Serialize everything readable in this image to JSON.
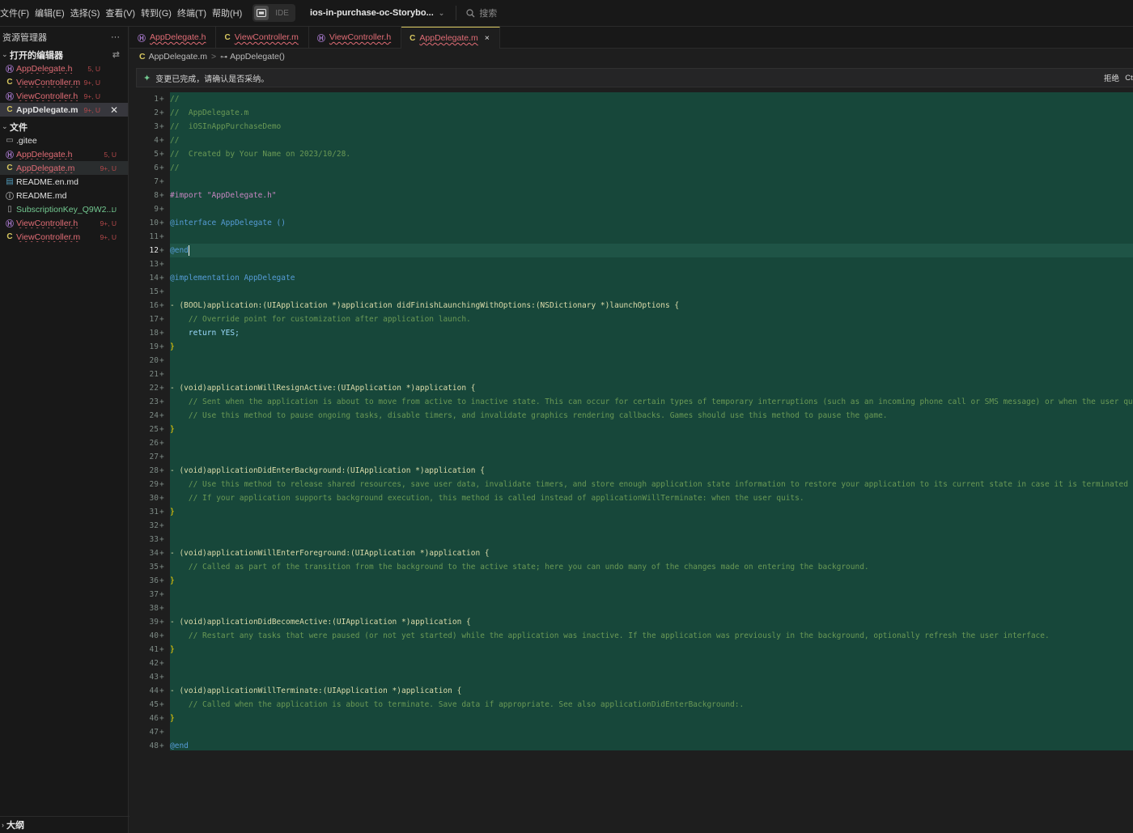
{
  "menu": [
    "文件(F)",
    "编辑(E)",
    "选择(S)",
    "查看(V)",
    "转到(G)",
    "终端(T)",
    "帮助(H)"
  ],
  "ide_label": "IDE",
  "project": "ios-in-purchase-oc-Storybo...",
  "search": "搜索",
  "sidebar": {
    "title": "资源管理器",
    "more": "···",
    "open_editors_title": "打开的编辑器",
    "open_editors": [
      {
        "icon": "Ⓗ",
        "name": "AppDelegate.h",
        "badge": "5, U"
      },
      {
        "icon": "C",
        "name": "ViewController.m",
        "badge": "9+, U"
      },
      {
        "icon": "Ⓗ",
        "name": "ViewController.h",
        "badge": "9+, U"
      },
      {
        "icon": "C",
        "name": "AppDelegate.m",
        "badge": "9+, U"
      }
    ],
    "files_title": "文件",
    "files": [
      {
        "icon": "▭",
        "name": ".gitee",
        "badge": ""
      },
      {
        "icon": "Ⓗ",
        "name": "AppDelegate.h",
        "badge": "5, U"
      },
      {
        "icon": "C",
        "name": "AppDelegate.m",
        "badge": "9+, U"
      },
      {
        "icon": "▤",
        "name": "README.en.md",
        "badge": ""
      },
      {
        "icon": "ⓘ",
        "name": "README.md",
        "badge": ""
      },
      {
        "icon": "▯",
        "name": "SubscriptionKey_Q9W2...",
        "badge": "U"
      },
      {
        "icon": "Ⓗ",
        "name": "ViewController.h",
        "badge": "9+, U"
      },
      {
        "icon": "C",
        "name": "ViewController.m",
        "badge": "9+, U"
      }
    ],
    "outline_title": "大纲"
  },
  "tabs": [
    {
      "icon": "Ⓗ",
      "name": "AppDelegate.h"
    },
    {
      "icon": "C",
      "name": "ViewController.m"
    },
    {
      "icon": "Ⓗ",
      "name": "ViewController.h"
    },
    {
      "icon": "C",
      "name": "AppDelegate.m",
      "close": "×"
    }
  ],
  "breadcrumb": {
    "file_icon": "C",
    "file": "AppDelegate.m",
    "sep": ">",
    "symbol_icon": "⊶",
    "symbol": "AppDelegate()"
  },
  "notice": {
    "icon": "✦",
    "text": "变更已完成，请确认是否采纳。",
    "reject": "拒绝",
    "accept": "Ctrl"
  },
  "code_lines": [
    "//",
    "//  AppDelegate.m",
    "//  iOSInAppPurchaseDemo",
    "//",
    "//  Created by Your Name on 2023/10/28.",
    "//",
    "",
    "#import \"AppDelegate.h\"",
    "",
    "@interface AppDelegate ()",
    "",
    "@end",
    "",
    "@implementation AppDelegate",
    "",
    "- (BOOL)application:(UIApplication *)application didFinishLaunchingWithOptions:(NSDictionary *)launchOptions {",
    "    // Override point for customization after application launch.",
    "    return YES;",
    "}",
    "",
    "",
    "- (void)applicationWillResignActive:(UIApplication *)application {",
    "    // Sent when the application is about to move from active to inactive state. This can occur for certain types of temporary interruptions (such as an incoming phone call or SMS message) or when the user quits the application and it begins the transition to the background state.",
    "    // Use this method to pause ongoing tasks, disable timers, and invalidate graphics rendering callbacks. Games should use this method to pause the game.",
    "}",
    "",
    "",
    "- (void)applicationDidEnterBackground:(UIApplication *)application {",
    "    // Use this method to release shared resources, save user data, invalidate timers, and store enough application state information to restore your application to its current state in case it is terminated later.",
    "    // If your application supports background execution, this method is called instead of applicationWillTerminate: when the user quits.",
    "}",
    "",
    "",
    "- (void)applicationWillEnterForeground:(UIApplication *)application {",
    "    // Called as part of the transition from the background to the active state; here you can undo many of the changes made on entering the background.",
    "}",
    "",
    "",
    "- (void)applicationDidBecomeActive:(UIApplication *)application {",
    "    // Restart any tasks that were paused (or not yet started) while the application was inactive. If the application was previously in the background, optionally refresh the user interface.",
    "}",
    "",
    "",
    "- (void)applicationWillTerminate:(UIApplication *)application {",
    "    // Called when the application is about to terminate. Save data if appropriate. See also applicationDidEnterBackground:.",
    "}",
    "",
    "@end"
  ],
  "current_line": 12,
  "gutter_marker": "+",
  "colors": {
    "accent": "#d8c860",
    "diff_add": "#17473a",
    "error": "#e06c75",
    "untracked": "#73c991"
  }
}
